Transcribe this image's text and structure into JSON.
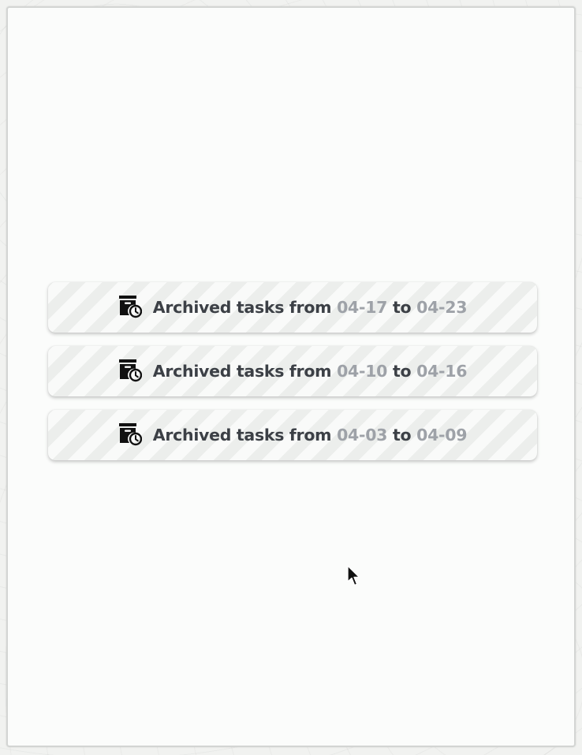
{
  "archives": [
    {
      "prefix": "Archived tasks from",
      "start": "04-17",
      "connector": "to",
      "end": "04-23",
      "icon": "archive-clock-icon"
    },
    {
      "prefix": "Archived tasks from",
      "start": "04-10",
      "connector": "to",
      "end": "04-16",
      "icon": "archive-clock-icon"
    },
    {
      "prefix": "Archived tasks from",
      "start": "04-03",
      "connector": "to",
      "end": "04-09",
      "icon": "archive-clock-icon"
    }
  ],
  "colors": {
    "text": "#3c4046",
    "date": "#9ea2a8",
    "stripe_light": "#f9faf9",
    "stripe_dark": "#eceeec",
    "panel": "#fbfcfb"
  }
}
